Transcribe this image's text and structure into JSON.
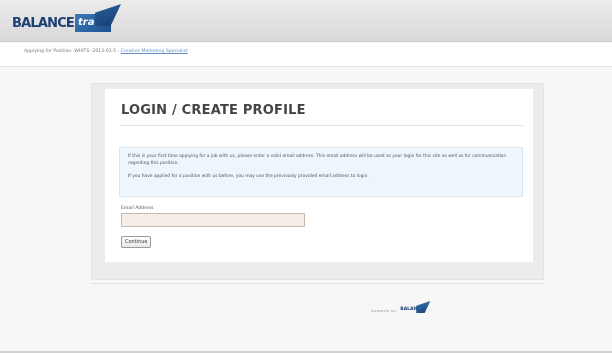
{
  "header": {
    "logo_text": "BALANCE",
    "logo_suffix": "trak"
  },
  "subbar": {
    "applying_prefix": "Applying for Position: WHITS -2013-03-5 -",
    "position_link": "Creative Marketing Specialist"
  },
  "main": {
    "title": "LOGIN / CREATE PROFILE",
    "info_paragraph_1": "If this is your first time applying for a job with us, please enter a valid email address. This email address will be used as your login for this site as well as for communication regarding this position.",
    "info_paragraph_2": "If you have applied for a position with us before, you may use the previously provided email address to login.",
    "email_label": "Email Address",
    "email_value": "",
    "continue_label": "Continue"
  },
  "footer": {
    "powered_by": "powered by",
    "mini_logo_text": "BALANCE"
  },
  "colors": {
    "brand_blue": "#1c3f75",
    "accent_blue": "#3c7ab8",
    "info_bg": "#eef5fb",
    "input_bg": "#f6ede6"
  }
}
